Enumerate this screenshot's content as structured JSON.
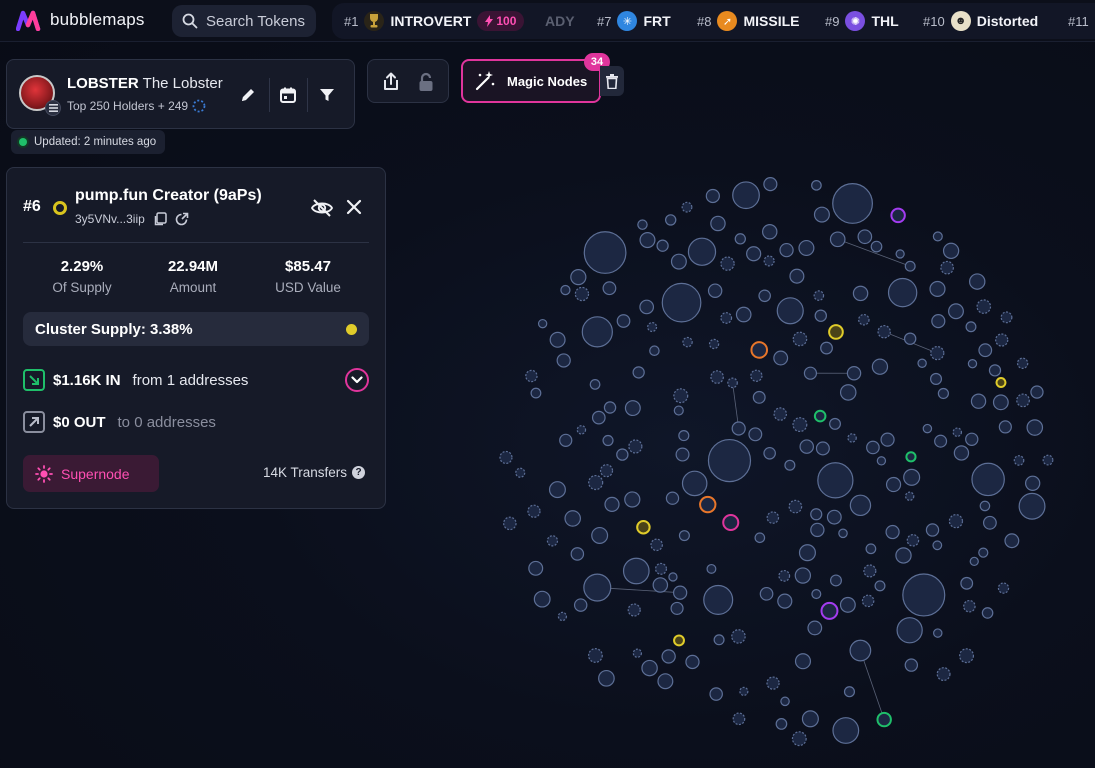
{
  "header": {
    "brand": "bubblemaps",
    "search_placeholder": "Search Tokens",
    "ticker": [
      {
        "rank": "#1",
        "name": "INTROVERT",
        "badge": "100",
        "icon_color": "#c9a23a",
        "icon": "trophy-icon"
      },
      {
        "rank": "",
        "name": "ADY",
        "faded": true
      },
      {
        "rank": "#7",
        "name": "FRT",
        "icon_color": "#2f86e0",
        "icon": "frt-logo-icon"
      },
      {
        "rank": "#8",
        "name": "MISSILE",
        "icon_color": "#e88a1f",
        "icon": "missile-logo-icon"
      },
      {
        "rank": "#9",
        "name": "THL",
        "icon_color": "#7a4fe0",
        "icon": "thl-logo-icon"
      },
      {
        "rank": "#10",
        "name": "Distorted",
        "icon_color": "#e8e0c8",
        "icon": "distorted-logo-icon"
      },
      {
        "rank": "#11",
        "name": ""
      }
    ]
  },
  "token": {
    "symbol": "LOBSTER",
    "name": "The Lobster",
    "subtitle": "Top 250 Holders + 249",
    "updated": "Updated: 2 minutes ago"
  },
  "toolbar": {
    "magic_label": "Magic Nodes",
    "magic_count": "34"
  },
  "detail": {
    "rank": "#6",
    "name": "pump.fun Creator (9aPs)",
    "address": "3y5VNv...3iip",
    "stats": [
      {
        "value": "2.29%",
        "label": "Of Supply"
      },
      {
        "value": "22.94M",
        "label": "Amount"
      },
      {
        "value": "$85.47",
        "label": "USD Value"
      }
    ],
    "cluster_supply": "Cluster Supply: 3.38%",
    "flow_in_amount": "$1.16K IN",
    "flow_in_desc": "from 1 addresses",
    "flow_out_amount": "$0 OUT",
    "flow_out_desc": "to 0 addresses",
    "supernode_label": "Supernode",
    "transfers": "14K Transfers"
  },
  "colors": {
    "accent_pink": "#e0359c",
    "cluster_yellow": "#e0cc2a",
    "node_fill": "#1c2742",
    "node_stroke": "#5d6f96",
    "green": "#1fbf6a",
    "purple": "#a33cf0",
    "orange": "#e8762a"
  }
}
